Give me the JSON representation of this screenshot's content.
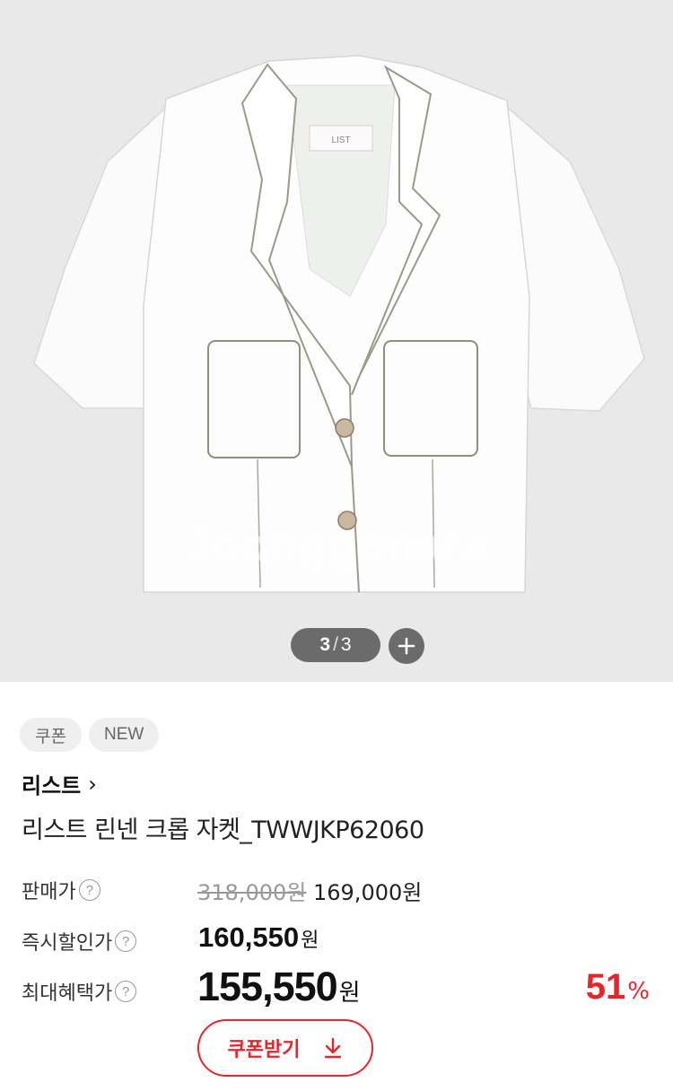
{
  "gallery": {
    "watermark": "Joonggonara",
    "garment_label": "LIST",
    "counter": {
      "current": "3",
      "separator": "/",
      "total": "3"
    }
  },
  "badges": [
    "쿠폰",
    "NEW"
  ],
  "brand": {
    "name": "리스트",
    "chevron": "›"
  },
  "product": {
    "title": "리스트 린넨 크롭 자켓_TWWJKP62060"
  },
  "pricing": {
    "sale_label": "판매가",
    "original_price": "318,000원",
    "sale_price": "169,000원",
    "instant_label": "즉시할인가",
    "instant_price": "160,550",
    "instant_unit": "원",
    "max_label": "최대혜택가",
    "max_price": "155,550",
    "max_unit": "원",
    "discount_value": "51",
    "discount_unit": "%",
    "help_glyph": "?"
  },
  "coupon_button": {
    "label": "쿠폰받기",
    "icon": "download-arrow-icon"
  },
  "colors": {
    "accent": "#e5262c",
    "counter_bg": "#6b6b6b",
    "gallery_bg": "#e9e9e9"
  }
}
